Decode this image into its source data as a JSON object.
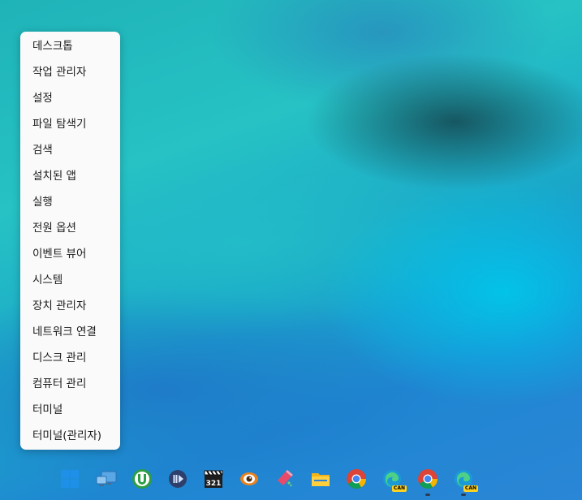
{
  "context_menu": {
    "items": [
      {
        "label": "데스크톱"
      },
      {
        "label": "작업 관리자"
      },
      {
        "label": "설정"
      },
      {
        "label": "파일 탐색기"
      },
      {
        "label": "검색"
      },
      {
        "label": "설치된 앱"
      },
      {
        "label": "실행"
      },
      {
        "label": "전원 옵션"
      },
      {
        "label": "이벤트 뷰어"
      },
      {
        "label": "시스템"
      },
      {
        "label": "장치 관리자"
      },
      {
        "label": "네트워크 연결"
      },
      {
        "label": "디스크 관리"
      },
      {
        "label": "컴퓨터 관리"
      },
      {
        "label": "터미널"
      },
      {
        "label": "터미널(관리자)"
      }
    ]
  },
  "taskbar": {
    "icons": [
      {
        "name": "start-windows-icon"
      },
      {
        "name": "remote-desktop-icon"
      },
      {
        "name": "utorrent-icon"
      },
      {
        "name": "media-player-icon"
      },
      {
        "name": "media-player-classic-icon"
      },
      {
        "name": "eye-viewer-icon"
      },
      {
        "name": "paint-app-icon"
      },
      {
        "name": "file-explorer-icon"
      },
      {
        "name": "chrome-icon"
      },
      {
        "name": "edge-canary-icon",
        "badge": "CAN"
      },
      {
        "name": "chrome-icon-2"
      },
      {
        "name": "edge-canary-icon-2",
        "badge": "CAN"
      }
    ],
    "clapper_text": "321"
  },
  "colors": {
    "menu_bg": "#fafafa",
    "wallpaper_teal": "#26c2c4",
    "wallpaper_blue": "#1f86d2"
  }
}
